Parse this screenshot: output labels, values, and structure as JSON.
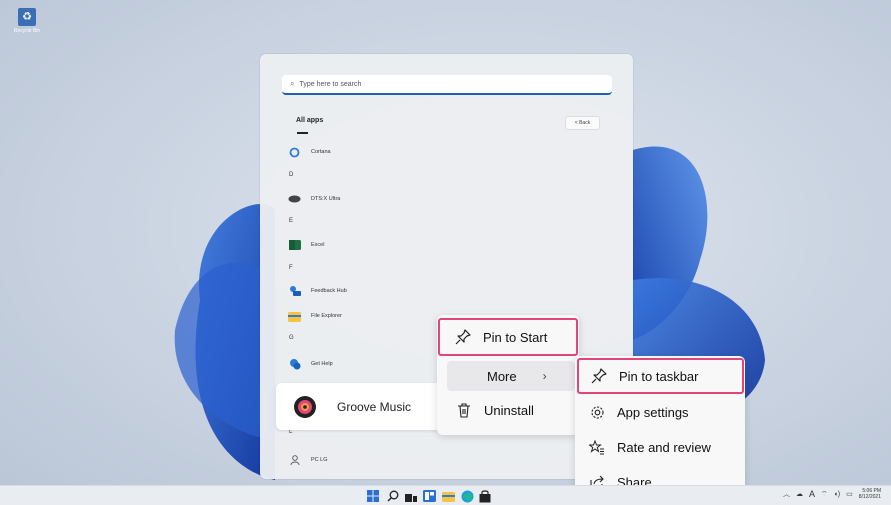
{
  "desktop": {
    "recycle_bin_label": "Recycle Bin"
  },
  "start_menu": {
    "search_placeholder": "Type here to search",
    "all_apps_title": "All apps",
    "back_label": "< Back",
    "sections": [
      {
        "type": "app",
        "name": "Cortana",
        "icon": "cortana-icon"
      },
      {
        "type": "letter",
        "name": "D"
      },
      {
        "type": "app",
        "name": "DTS:X Ultra",
        "icon": "dtsx-icon"
      },
      {
        "type": "letter",
        "name": "E"
      },
      {
        "type": "app",
        "name": "Excel",
        "icon": "excel-icon"
      },
      {
        "type": "letter",
        "name": "F"
      },
      {
        "type": "app",
        "name": "Feedback Hub",
        "icon": "feedback-hub-icon"
      },
      {
        "type": "app",
        "name": "File Explorer",
        "icon": "file-explorer-icon"
      },
      {
        "type": "letter",
        "name": "G"
      },
      {
        "type": "app",
        "name": "Get Help",
        "icon": "get-help-icon"
      },
      {
        "type": "letter",
        "name": "L"
      },
      {
        "type": "app",
        "name": "PC LG",
        "icon": "pc-icon"
      }
    ],
    "groove_tile": {
      "name": "Groove Music",
      "icon": "groove-music-icon"
    }
  },
  "context_menu": {
    "items": [
      {
        "label": "Pin to Start",
        "icon": "pin-icon",
        "highlighted": true
      },
      {
        "label": "More",
        "icon": "",
        "has_submenu": true
      },
      {
        "label": "Uninstall",
        "icon": "trash-icon"
      }
    ]
  },
  "submenu": {
    "items": [
      {
        "label": "Pin to taskbar",
        "icon": "pin-icon",
        "highlighted": true
      },
      {
        "label": "App settings",
        "icon": "gear-icon"
      },
      {
        "label": "Rate and review",
        "icon": "rate-review-icon"
      },
      {
        "label": "Share",
        "icon": "share-icon"
      }
    ]
  },
  "taskbar": {
    "icons": [
      "start-icon",
      "search-icon",
      "task-view-icon",
      "widgets-icon",
      "file-explorer-icon",
      "edge-icon",
      "store-icon"
    ],
    "tray": {
      "time": "5:06 PM",
      "date": "8/12/2021",
      "input_indicator": "A"
    }
  },
  "colors": {
    "highlight_border": "#e0457b",
    "accent": "#1f5fb5"
  }
}
